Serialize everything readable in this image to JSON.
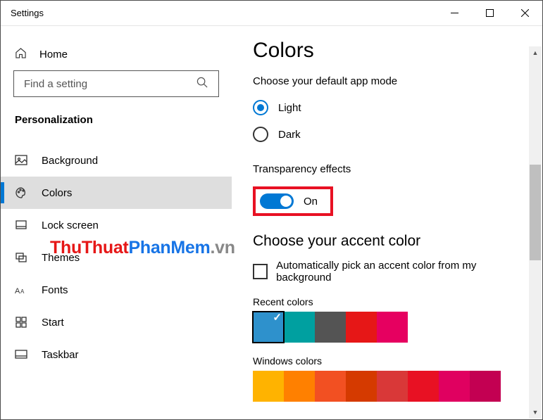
{
  "window": {
    "title": "Settings"
  },
  "sidebar": {
    "home": "Home",
    "search_placeholder": "Find a setting",
    "section": "Personalization",
    "items": [
      {
        "label": "Background"
      },
      {
        "label": "Colors"
      },
      {
        "label": "Lock screen"
      },
      {
        "label": "Themes"
      },
      {
        "label": "Fonts"
      },
      {
        "label": "Start"
      },
      {
        "label": "Taskbar"
      }
    ]
  },
  "page": {
    "header": "Colors",
    "default_mode_label": "Choose your default app mode",
    "mode_light": "Light",
    "mode_dark": "Dark",
    "transparency_label": "Transparency effects",
    "transparency_state": "On",
    "accent_header": "Choose your accent color",
    "auto_accent_label": "Automatically pick an accent color from my background",
    "recent_colors_label": "Recent colors",
    "recent_colors": [
      "#2e91cc",
      "#00a0a0",
      "#545454",
      "#e61717",
      "#e60060"
    ],
    "windows_colors_label": "Windows colors",
    "windows_colors": [
      "#ffb300",
      "#ff8000",
      "#f25022",
      "#d53a00",
      "#d93838",
      "#e81123",
      "#e00060",
      "#c30052"
    ]
  },
  "watermark": {
    "part1": "ThuThuat",
    "part2": "PhanMem",
    "part3": ".vn"
  },
  "annotation": {
    "highlight_color": "#e81123"
  }
}
